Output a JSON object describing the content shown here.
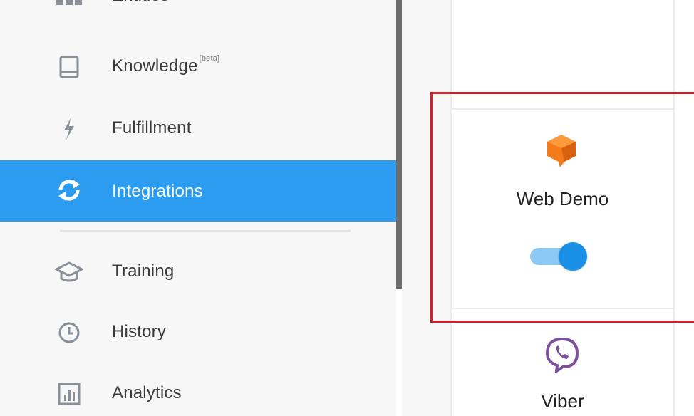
{
  "sidebar": {
    "items": [
      {
        "label": "Entities",
        "icon": "entities-icon"
      },
      {
        "label": "Knowledge",
        "badge": "[beta]",
        "icon": "book-icon"
      },
      {
        "label": "Fulfillment",
        "icon": "lightning-icon"
      },
      {
        "label": "Integrations",
        "icon": "sync-arrows-icon",
        "active": true
      },
      {
        "label": "Training",
        "icon": "graduation-cap-icon"
      },
      {
        "label": "History",
        "icon": "clock-icon"
      },
      {
        "label": "Analytics",
        "icon": "bar-chart-icon"
      }
    ]
  },
  "integrations": {
    "cards": [
      {
        "title": "Web Demo",
        "icon": "web-demo-speech-bubble-icon",
        "enabled": true
      },
      {
        "title": "Viber",
        "icon": "viber-phone-icon"
      }
    ]
  },
  "colors": {
    "active_nav": "#2b9cf0",
    "toggle_on": "#1a8fe6",
    "highlight_border": "#d0202a",
    "web_demo_orange": "#f47a1a",
    "viber_purple": "#7b519d"
  }
}
